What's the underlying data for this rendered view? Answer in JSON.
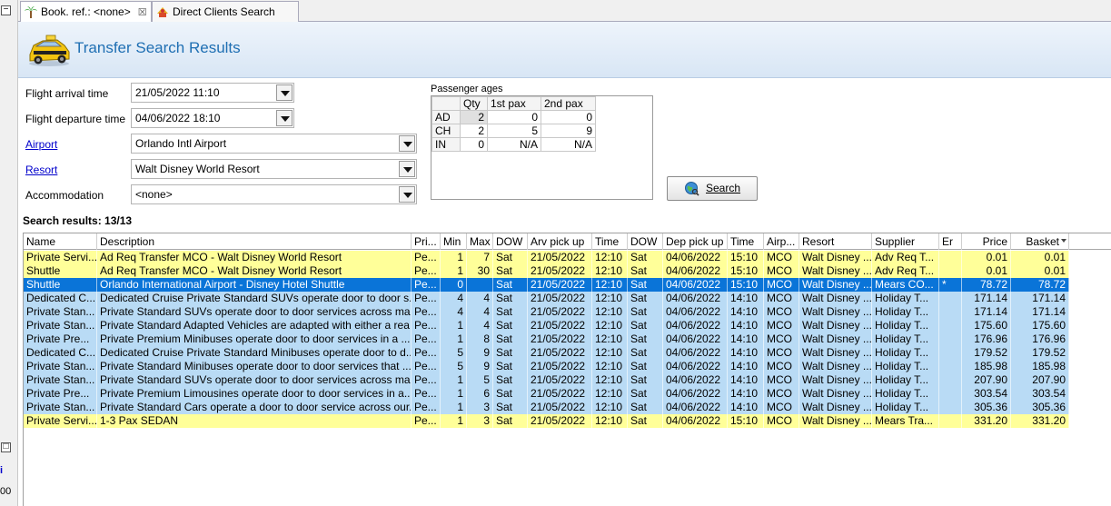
{
  "left_strip": {
    "frag1": "i",
    "frag2": "00"
  },
  "tabs": [
    {
      "label": "Book. ref.: <none>",
      "close": "☒"
    },
    {
      "label": "Direct Clients Search"
    }
  ],
  "header": {
    "title": "Transfer Search Results"
  },
  "form": {
    "arrival_label": "Flight arrival time",
    "arrival_value": "21/05/2022 11:10",
    "departure_label": "Flight departure time",
    "departure_value": "04/06/2022 18:10",
    "airport_label": "Airport",
    "airport_value": "Orlando Intl Airport",
    "resort_label": "Resort",
    "resort_value": "Walt Disney World Resort",
    "accommodation_label": "Accommodation",
    "accommodation_value": "<none>"
  },
  "pax": {
    "label": "Passenger ages",
    "headers": [
      "",
      "Qty",
      "1st pax",
      "2nd pax"
    ],
    "rows": [
      {
        "type": "AD",
        "qty": "2",
        "p1": "0",
        "p2": "0"
      },
      {
        "type": "CH",
        "qty": "2",
        "p1": "5",
        "p2": "9"
      },
      {
        "type": "IN",
        "qty": "0",
        "p1": "N/A",
        "p2": "N/A"
      }
    ]
  },
  "search_button": {
    "label": "Search"
  },
  "results_line": "Search results: 13/13",
  "grid": {
    "columns": [
      "Name",
      "Description",
      "Pri...",
      "Min",
      "Max",
      "DOW",
      "Arv pick up",
      "Time",
      "DOW",
      "Dep pick up",
      "Time",
      "Airp...",
      "Resort",
      "Supplier",
      "Er",
      "Price",
      "Basket"
    ],
    "rows": [
      {
        "style": "yellow",
        "c": [
          "Private Servi...",
          "Ad Req Transfer MCO - Walt Disney World Resort",
          "Pe...",
          "1",
          "7",
          "Sat",
          "21/05/2022",
          "12:10",
          "Sat",
          "04/06/2022",
          "15:10",
          "MCO",
          "Walt Disney ...",
          "Adv Req T...",
          "",
          "0.01",
          "0.01"
        ]
      },
      {
        "style": "yellow",
        "c": [
          "Shuttle",
          "Ad Req Transfer MCO - Walt Disney World Resort",
          "Pe...",
          "1",
          "30",
          "Sat",
          "21/05/2022",
          "12:10",
          "Sat",
          "04/06/2022",
          "15:10",
          "MCO",
          "Walt Disney ...",
          "Adv Req T...",
          "",
          "0.01",
          "0.01"
        ]
      },
      {
        "style": "sel",
        "c": [
          "Shuttle",
          "Orlando International Airport - Disney Hotel Shuttle",
          "Pe...",
          "0",
          "",
          "Sat",
          "21/05/2022",
          "12:10",
          "Sat",
          "04/06/2022",
          "15:10",
          "MCO",
          "Walt Disney ...",
          "Mears CO...",
          "*",
          "78.72",
          "78.72"
        ]
      },
      {
        "style": "blue",
        "c": [
          "Dedicated C...",
          "Dedicated Cruise Private Standard SUVs operate door to door s...",
          "Pe...",
          "4",
          "4",
          "Sat",
          "21/05/2022",
          "12:10",
          "Sat",
          "04/06/2022",
          "14:10",
          "MCO",
          "Walt Disney ...",
          "Holiday T...",
          "",
          "171.14",
          "171.14"
        ]
      },
      {
        "style": "blue",
        "c": [
          "Private Stan...",
          "Private Standard SUVs operate door to door services across ma...",
          "Pe...",
          "4",
          "4",
          "Sat",
          "21/05/2022",
          "12:10",
          "Sat",
          "04/06/2022",
          "14:10",
          "MCO",
          "Walt Disney ...",
          "Holiday T...",
          "",
          "171.14",
          "171.14"
        ]
      },
      {
        "style": "blue",
        "c": [
          "Private Stan...",
          "Private Standard Adapted Vehicles are adapted with either a rea...",
          "Pe...",
          "1",
          "4",
          "Sat",
          "21/05/2022",
          "12:10",
          "Sat",
          "04/06/2022",
          "14:10",
          "MCO",
          "Walt Disney ...",
          "Holiday T...",
          "",
          "175.60",
          "175.60"
        ]
      },
      {
        "style": "blue",
        "c": [
          "Private Pre...",
          "Private Premium Minibuses operate door to door services in a ...",
          "Pe...",
          "1",
          "8",
          "Sat",
          "21/05/2022",
          "12:10",
          "Sat",
          "04/06/2022",
          "14:10",
          "MCO",
          "Walt Disney ...",
          "Holiday T...",
          "",
          "176.96",
          "176.96"
        ]
      },
      {
        "style": "blue",
        "c": [
          "Dedicated C...",
          "Dedicated Cruise Private Standard Minibuses operate door to d...",
          "Pe...",
          "5",
          "9",
          "Sat",
          "21/05/2022",
          "12:10",
          "Sat",
          "04/06/2022",
          "14:10",
          "MCO",
          "Walt Disney ...",
          "Holiday T...",
          "",
          "179.52",
          "179.52"
        ]
      },
      {
        "style": "blue",
        "c": [
          "Private Stan...",
          "Private Standard Minibuses operate door to door services that ...",
          "Pe...",
          "5",
          "9",
          "Sat",
          "21/05/2022",
          "12:10",
          "Sat",
          "04/06/2022",
          "14:10",
          "MCO",
          "Walt Disney ...",
          "Holiday T...",
          "",
          "185.98",
          "185.98"
        ]
      },
      {
        "style": "blue",
        "c": [
          "Private Stan...",
          "Private Standard SUVs operate door to door services across ma...",
          "Pe...",
          "1",
          "5",
          "Sat",
          "21/05/2022",
          "12:10",
          "Sat",
          "04/06/2022",
          "14:10",
          "MCO",
          "Walt Disney ...",
          "Holiday T...",
          "",
          "207.90",
          "207.90"
        ]
      },
      {
        "style": "blue",
        "c": [
          "Private Pre...",
          "Private Premium Limousines operate door to door services in a...",
          "Pe...",
          "1",
          "6",
          "Sat",
          "21/05/2022",
          "12:10",
          "Sat",
          "04/06/2022",
          "14:10",
          "MCO",
          "Walt Disney ...",
          "Holiday T...",
          "",
          "303.54",
          "303.54"
        ]
      },
      {
        "style": "blue",
        "c": [
          "Private Stan...",
          "Private Standard Cars operate a door to door service across our...",
          "Pe...",
          "1",
          "3",
          "Sat",
          "21/05/2022",
          "12:10",
          "Sat",
          "04/06/2022",
          "14:10",
          "MCO",
          "Walt Disney ...",
          "Holiday T...",
          "",
          "305.36",
          "305.36"
        ]
      },
      {
        "style": "yellow",
        "c": [
          "Private Servi...",
          "1-3 Pax SEDAN",
          "Pe...",
          "1",
          "3",
          "Sat",
          "21/05/2022",
          "12:10",
          "Sat",
          "04/06/2022",
          "15:10",
          "MCO",
          "Walt Disney ...",
          "Mears Tra...",
          "",
          "331.20",
          "331.20"
        ]
      }
    ]
  }
}
